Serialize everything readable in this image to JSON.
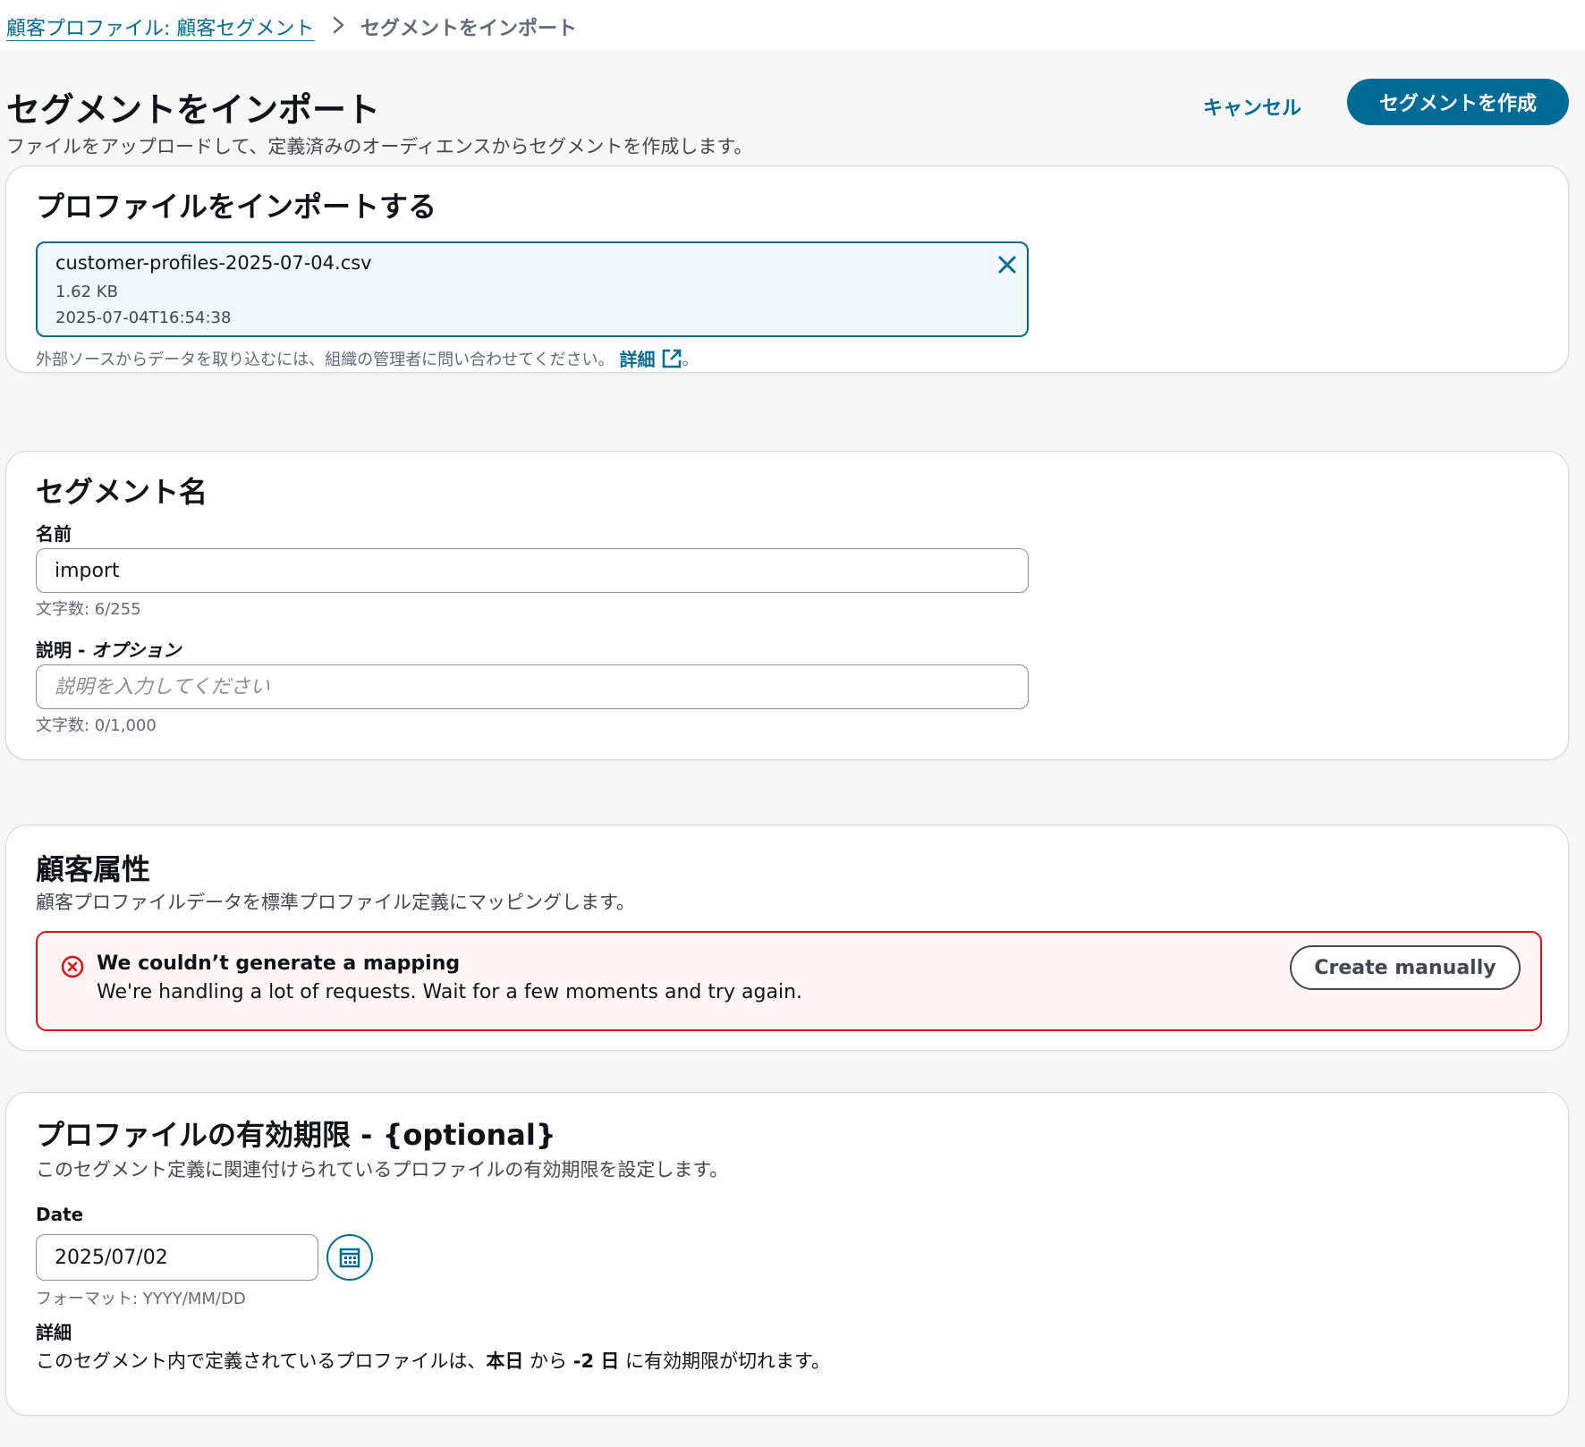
{
  "breadcrumb": {
    "parent": "顧客プロファイル: 顧客セグメント",
    "current": "セグメントをインポート"
  },
  "header": {
    "title": "セグメントをインポート",
    "description": "ファイルをアップロードして、定義済みのオーディエンスからセグメントを作成します。",
    "cancel_label": "キャンセル",
    "create_label": "セグメントを作成"
  },
  "import_section": {
    "title": "プロファイルをインポートする",
    "file": {
      "name": "customer-profiles-2025-07-04.csv",
      "size": "1.62 KB",
      "modified": "2025-07-04T16:54:38"
    },
    "help_text": "外部ソースからデータを取り込むには、組織の管理者に問い合わせてください。",
    "help_link": "詳細",
    "help_suffix": "。"
  },
  "segment_section": {
    "title": "セグメント名",
    "name_label": "名前",
    "name_value": "import",
    "name_counter": "文字数: 6/255",
    "desc_label": "説明 - ",
    "desc_optional": "オプション",
    "desc_placeholder": "説明を入力してください",
    "desc_counter": "文字数: 0/1,000"
  },
  "attributes_section": {
    "title": "顧客属性",
    "subtitle": "顧客プロファイルデータを標準プロファイル定義にマッピングします。",
    "alert": {
      "title": "We couldn’t generate a mapping",
      "text": "We're handling a lot of requests. Wait for a few moments and try again.",
      "button": "Create manually"
    }
  },
  "expiry_section": {
    "title": "プロファイルの有効期限 - {optional}",
    "subtitle": "このセグメント定義に関連付けられているプロファイルの有効期限を設定します。",
    "date_label": "Date",
    "date_value": "2025/07/02",
    "date_format": "フォーマット: YYYY/MM/DD",
    "detail_label": "詳細",
    "detail_pre": "このセグメント内で定義されているプロファイルは、",
    "detail_today": "本日",
    "detail_from": " から ",
    "detail_days": "-2 日",
    "detail_post": " に有効期限が切れます。"
  },
  "colors": {
    "primary": "#006b96",
    "error": "#d91515",
    "page_bg": "#f7f7f7"
  },
  "icons": [
    "chevron-right-icon",
    "close-icon",
    "external-link-icon",
    "error-icon",
    "calendar-icon"
  ]
}
